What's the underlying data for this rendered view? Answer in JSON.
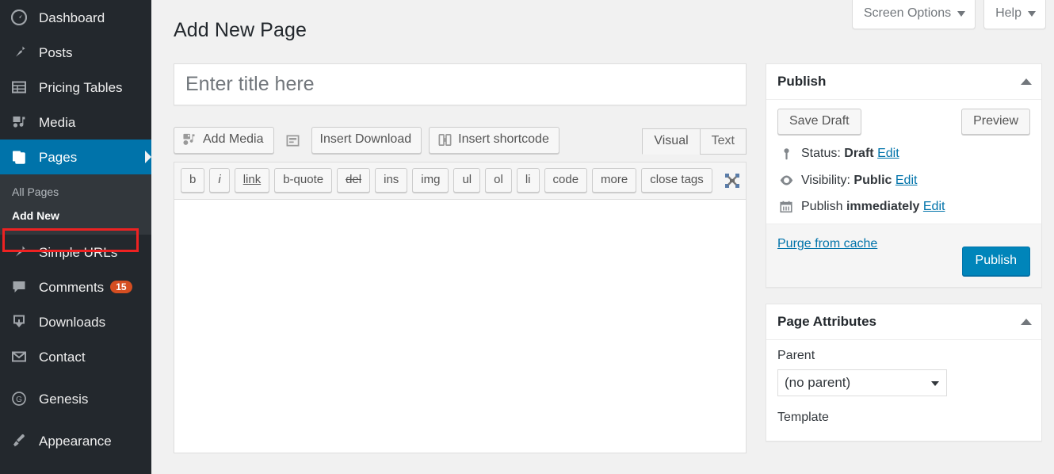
{
  "sidebar": {
    "items": [
      {
        "label": "Dashboard",
        "icon": "dashboard-icon",
        "current": false
      },
      {
        "label": "Posts",
        "icon": "pin-icon",
        "current": false
      },
      {
        "label": "Pricing Tables",
        "icon": "table-icon",
        "current": false
      },
      {
        "label": "Media",
        "icon": "media-icon",
        "current": false
      },
      {
        "label": "Pages",
        "icon": "pages-icon",
        "current": true
      },
      {
        "label": "Simple URLs",
        "icon": "pin-icon",
        "current": false
      },
      {
        "label": "Comments",
        "icon": "comment-icon",
        "current": false,
        "badge": "15"
      },
      {
        "label": "Downloads",
        "icon": "download-icon",
        "current": false
      },
      {
        "label": "Contact",
        "icon": "envelope-icon",
        "current": false
      },
      {
        "label": "Genesis",
        "icon": "genesis-icon",
        "current": false
      },
      {
        "label": "Appearance",
        "icon": "brush-icon",
        "current": false
      }
    ],
    "submenu": [
      {
        "label": "All Pages",
        "current": false
      },
      {
        "label": "Add New",
        "current": true
      }
    ],
    "highlight_color": "#ee2222",
    "current_color": "#0073aa"
  },
  "header": {
    "screen_options_label": "Screen Options",
    "help_label": "Help",
    "page_title": "Add New Page"
  },
  "editor": {
    "title_placeholder": "Enter title here",
    "title_value": "",
    "media_buttons": [
      {
        "label": "Add Media",
        "icon": "add-media-icon"
      },
      {
        "label": "",
        "icon": "contact-form-icon"
      },
      {
        "label": "Insert Download",
        "icon": "none"
      },
      {
        "label": "Insert shortcode",
        "icon": "shortcode-icon"
      }
    ],
    "tabs": [
      {
        "label": "Visual",
        "active": false
      },
      {
        "label": "Text",
        "active": true
      }
    ],
    "quicktags": [
      {
        "label": "b",
        "style": "bold"
      },
      {
        "label": "i",
        "style": "italic"
      },
      {
        "label": "link",
        "style": "underline"
      },
      {
        "label": "b-quote",
        "style": "normal"
      },
      {
        "label": "del",
        "style": "strike"
      },
      {
        "label": "ins",
        "style": "normal"
      },
      {
        "label": "img",
        "style": "normal"
      },
      {
        "label": "ul",
        "style": "normal"
      },
      {
        "label": "ol",
        "style": "normal"
      },
      {
        "label": "li",
        "style": "normal"
      },
      {
        "label": "code",
        "style": "normal"
      },
      {
        "label": "more",
        "style": "normal"
      },
      {
        "label": "close tags",
        "style": "normal"
      }
    ],
    "fullscreen_icon": "distraction-free-icon",
    "content_value": ""
  },
  "publish_box": {
    "title": "Publish",
    "save_draft_label": "Save Draft",
    "preview_label": "Preview",
    "status_prefix": "Status:",
    "status_value": "Draft",
    "status_edit": "Edit",
    "visibility_prefix": "Visibility:",
    "visibility_value": "Public",
    "visibility_edit": "Edit",
    "schedule_prefix": "Publish",
    "schedule_value": "immediately",
    "schedule_edit": "Edit",
    "purge_label": "Purge from cache",
    "publish_label": "Publish",
    "publish_color": "#0085ba"
  },
  "page_attributes": {
    "title": "Page Attributes",
    "parent_label": "Parent",
    "parent_value": "(no parent)",
    "template_label": "Template"
  }
}
